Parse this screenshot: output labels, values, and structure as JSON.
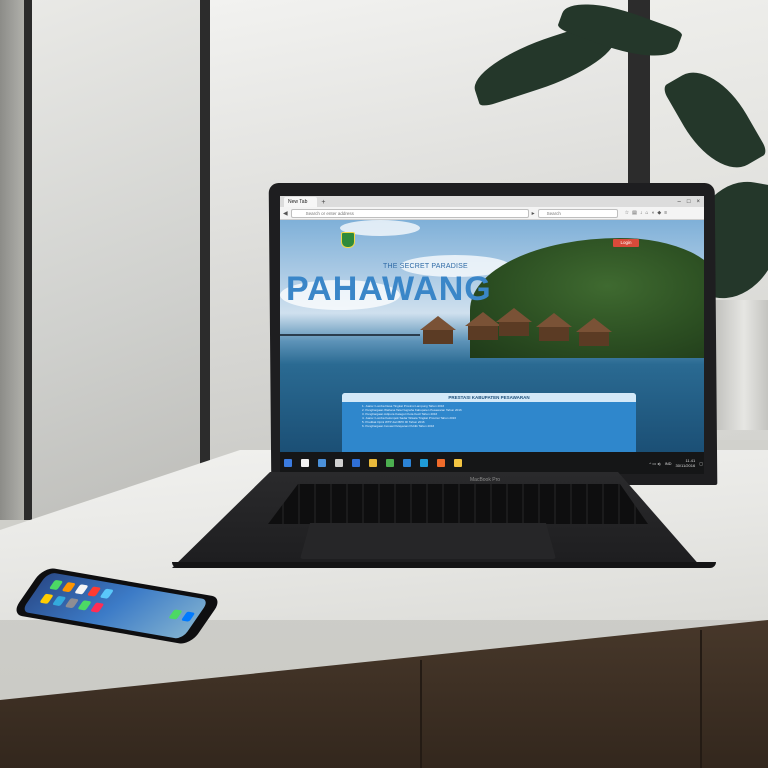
{
  "browser": {
    "tab_title": "New Tab",
    "new_tab_symbol": "+",
    "url_placeholder": "Search or enter address",
    "search_placeholder": "Search",
    "window_controls": [
      "–",
      "□",
      "×"
    ],
    "nav_icons": [
      "arrow-left-icon",
      "arrow-right-icon",
      "reload-icon"
    ]
  },
  "website": {
    "tagline": "THE SECRET PARADISE",
    "title": "PAHAWANG",
    "login_label": "Login",
    "panel_heading": "PRESTASI KABUPATEN PESAWARAN",
    "panel_lines": [
      "1. Juara I Lomba Desa Tingkat Provinsi Lampung Tahun 2016",
      "2. Penghargaan Wahana Tata Nugraha Kabupaten Pesawaran Tahun 2016",
      "3. Penghargaan Adipura Kategori Kota Kecil Tahun 2016",
      "4. Juara I Lomba Kelompok Sadar Wisata Tingkat Provinsi Tahun 2016",
      "5. Predikat Opini WTP dari BPK RI Tahun 2016",
      "6. Penghargaan Inovasi Pelayanan Publik Tahun 2016"
    ]
  },
  "taskbar": {
    "language": "IND",
    "time": "11.41",
    "date": "30/11/2016",
    "icon_colors": [
      "#3b7be0",
      "#f2f2f2",
      "#4a90d9",
      "#d0d0d0",
      "#2f6fd6",
      "#e8b93b",
      "#4caf50",
      "#2b83d6",
      "#1f9cd8",
      "#f06b2a",
      "#f4c542"
    ]
  },
  "laptop": {
    "brand": "MacBook Pro"
  },
  "colors": {
    "hero_title": "#3a86c8",
    "login_button": "#d94a3a",
    "panel_body": "#2f87cc"
  }
}
